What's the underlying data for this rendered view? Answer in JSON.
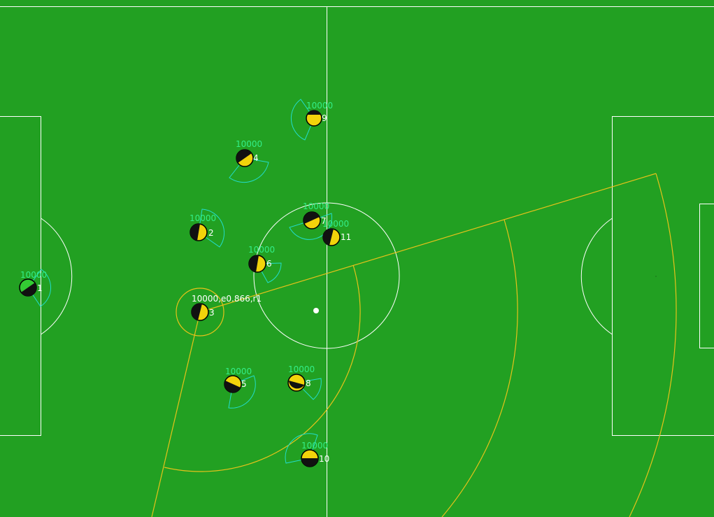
{
  "colors": {
    "pitch": "#22a022",
    "line": "#ffffff",
    "team_body": "#f2d30b",
    "goalie_body": "#33cc33",
    "player_outline": "#000000",
    "view_cone": "#22ddcc",
    "stamina_text": "#33ee88",
    "focus": "#e6c21a",
    "ball": "#ffffff"
  },
  "players": [
    {
      "number": "1",
      "stamina": "10000",
      "goalie": true
    },
    {
      "number": "2",
      "stamina": "10000"
    },
    {
      "number": "3",
      "stamina": "10000,e0.866,r1",
      "selected": true
    },
    {
      "number": "4",
      "stamina": "10000"
    },
    {
      "number": "5",
      "stamina": "10000"
    },
    {
      "number": "6",
      "stamina": "10000"
    },
    {
      "number": "7",
      "stamina": "10000"
    },
    {
      "number": "8",
      "stamina": "10000"
    },
    {
      "number": "9",
      "stamina": "10000"
    },
    {
      "number": "10",
      "stamina": "10000"
    },
    {
      "number": "11",
      "stamina": "10000"
    }
  ]
}
